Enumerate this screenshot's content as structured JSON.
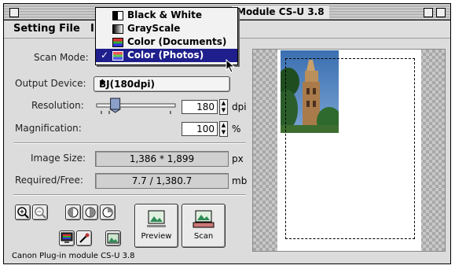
{
  "window": {
    "title": "Module CS-U 3.8"
  },
  "menubar": {
    "setting_file": "Setting File",
    "partial_menu": "I"
  },
  "scan_mode": {
    "label": "Scan Mode:",
    "options": [
      "Black & White",
      "GrayScale",
      "Color (Documents)",
      "Color (Photos)"
    ],
    "selected": "Color (Photos)",
    "check_mark": "✓"
  },
  "output_device": {
    "label": "Output Device:",
    "value": "BJ(180dpi)"
  },
  "resolution": {
    "label": "Resolution:",
    "value": "180",
    "unit": "dpi",
    "slider_fraction": 0.2
  },
  "magnification": {
    "label": "Magnification:",
    "value": "100",
    "unit": "%"
  },
  "image_size": {
    "label": "Image Size:",
    "value": "1,386 * 1,899",
    "unit": "px"
  },
  "required_free": {
    "label": "Required/Free:",
    "value": "7.7 / 1,380.7",
    "unit": "mb"
  },
  "buttons": {
    "preview": "Preview",
    "scan": "Scan"
  },
  "status": {
    "text": "Canon Plug-in module CS-U 3.8"
  },
  "colors": {
    "selection": "#1e1e8c",
    "window_bg": "#dcdcdc"
  }
}
